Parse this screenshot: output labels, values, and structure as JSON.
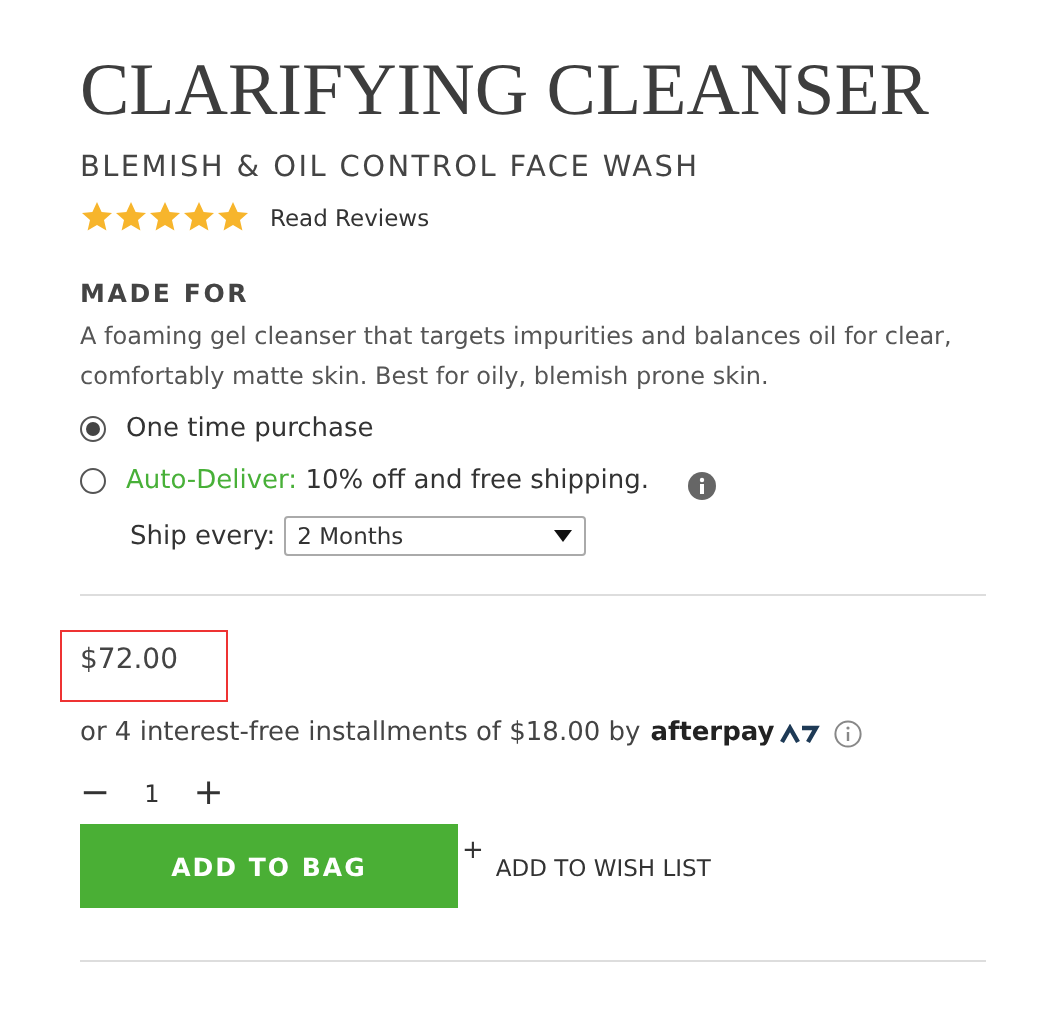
{
  "title": "CLARIFYING CLEANSER",
  "subtitle": "BLEMISH & OIL CONTROL FACE WASH",
  "rating": {
    "stars": 5,
    "link": "Read Reviews"
  },
  "made_for": {
    "heading": "MADE FOR",
    "description": "A foaming gel cleanser that targets impurities and balances oil for clear, comfortably matte skin. Best for oily, blemish prone skin."
  },
  "purchase_options": [
    {
      "label": "One time purchase",
      "selected": true
    },
    {
      "highlight": "Auto-Deliver:",
      "label": "10% off and free shipping.",
      "selected": false,
      "info": true
    }
  ],
  "ship_every": {
    "label": "Ship every:",
    "value": "2 Months"
  },
  "price": "$72.00",
  "installments": {
    "text": "or 4 interest-free installments of $18.00 by",
    "brand": "afterpay"
  },
  "quantity": {
    "minus": "−",
    "value": "1",
    "plus": "+"
  },
  "add_to_bag": "ADD TO BAG",
  "wish_list": {
    "plus": "+",
    "label": "ADD TO WISH LIST"
  }
}
